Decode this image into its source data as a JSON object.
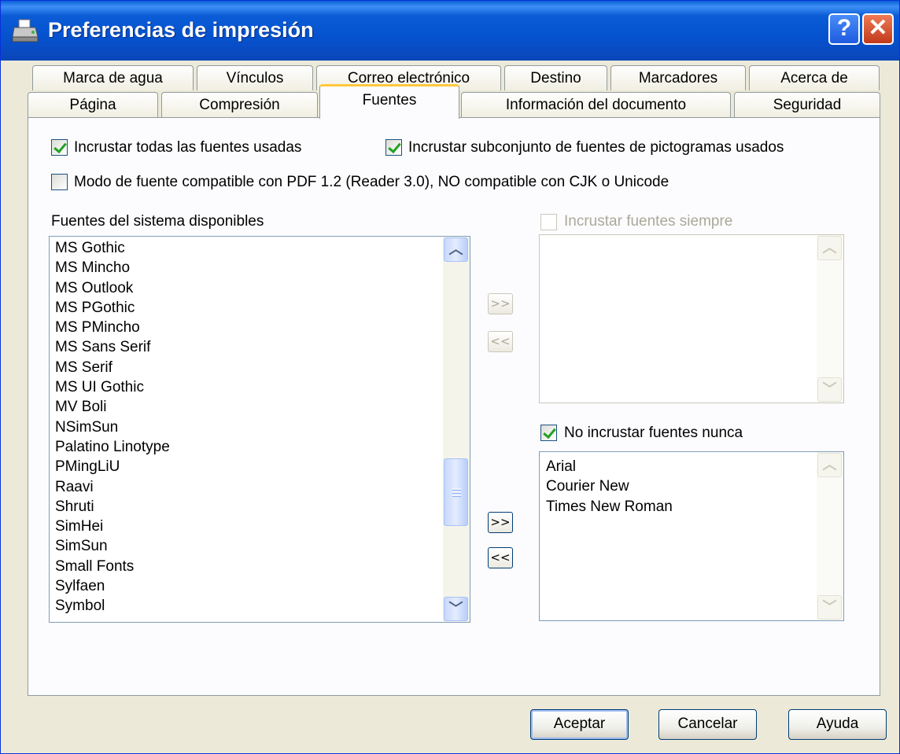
{
  "window": {
    "title": "Preferencias de impresión",
    "help_label": "?",
    "close_label": "✕"
  },
  "tabs_top": [
    "Marca de agua",
    "Vínculos",
    "Correo electrónico",
    "Destino",
    "Marcadores",
    "Acerca de"
  ],
  "tabs_bottom": [
    "Página",
    "Compresión",
    "Fuentes",
    "Información del documento",
    "Seguridad"
  ],
  "active_tab": "Fuentes",
  "options": {
    "embed_all": {
      "label": "Incrustar todas las fuentes usadas",
      "checked": true
    },
    "embed_subset": {
      "label": "Incrustar subconjunto de fuentes de pictogramas usados",
      "checked": true
    },
    "pdf12_mode": {
      "label": "Modo de fuente compatible con PDF 1.2 (Reader 3.0), NO compatible con CJK o Unicode",
      "checked": false
    }
  },
  "system_fonts": {
    "label": "Fuentes del sistema disponibles",
    "items": [
      "MS Gothic",
      "MS Mincho",
      "MS Outlook",
      "MS PGothic",
      "MS PMincho",
      "MS Sans Serif",
      "MS Serif",
      "MS UI Gothic",
      "MV Boli",
      "NSimSun",
      "Palatino Linotype",
      "PMingLiU",
      "Raavi",
      "Shruti",
      "SimHei",
      "SimSun",
      "Small Fonts",
      "Sylfaen",
      "Symbol"
    ]
  },
  "always_embed": {
    "label": "Incrustar fuentes siempre",
    "checked": false,
    "disabled": true,
    "items": []
  },
  "never_embed": {
    "label": "No incrustar fuentes nunca",
    "checked": true,
    "items": [
      "Arial",
      "Courier New",
      "Times New Roman"
    ]
  },
  "move_buttons": {
    "add": ">>",
    "remove": "<<"
  },
  "buttons": {
    "ok": "Aceptar",
    "cancel": "Cancelar",
    "help": "Ayuda"
  }
}
